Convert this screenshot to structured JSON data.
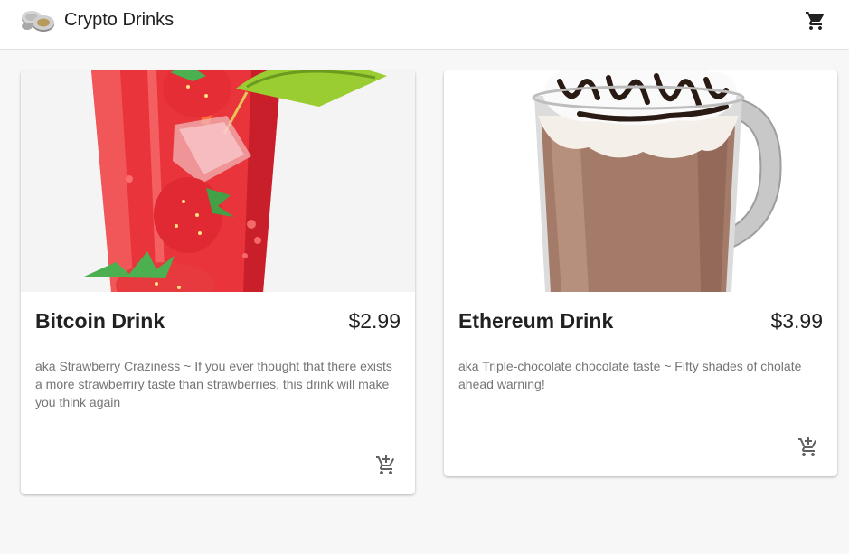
{
  "appbar": {
    "title": "Crypto Drinks",
    "logo_icon": "coins-icon",
    "cart_icon": "shopping-cart-icon"
  },
  "products": [
    {
      "name": "Bitcoin Drink",
      "price": "$2.99",
      "description": "aka Strawberry Craziness ~ If you ever thought that there exists a more strawberriry taste than strawberries, this drink will make you think again",
      "image": "strawberry-drink-image",
      "add_icon": "add-shopping-cart-icon"
    },
    {
      "name": "Ethereum Drink",
      "price": "$3.99",
      "description": "aka Triple-chocolate chocolate taste ~ Fifty shades of cholate ahead warning!",
      "image": "hot-chocolate-image",
      "add_icon": "add-shopping-cart-icon"
    }
  ],
  "colors": {
    "background": "#f7f7f7",
    "surface": "#ffffff",
    "text_primary": "#212121",
    "text_secondary": "#757575",
    "icon": "#616161"
  }
}
